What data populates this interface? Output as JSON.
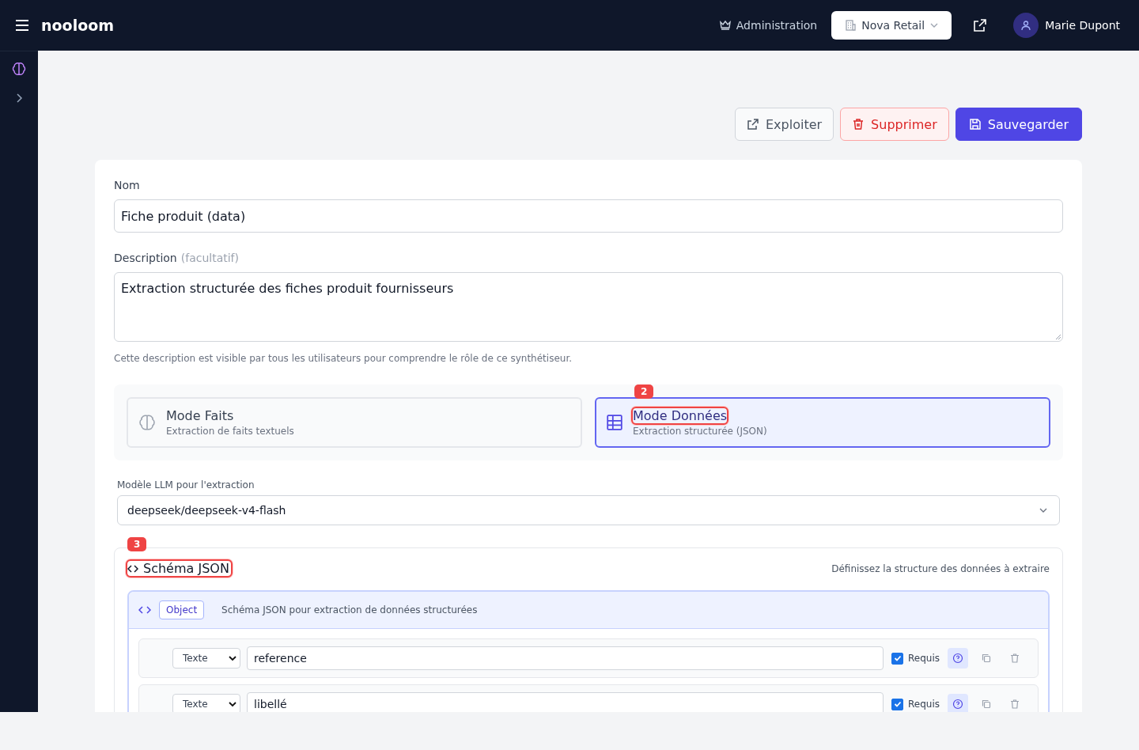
{
  "header": {
    "brand": "nooloom",
    "admin": "Administration",
    "org": "Nova Retail",
    "user": "Marie Dupont"
  },
  "actions": [
    "Exploiter",
    "Supprimer",
    "Sauvegarder"
  ],
  "form": {
    "name_label": "Nom",
    "name_value": "Fiche produit (data)",
    "desc_label": "Description",
    "desc_optional": "(facultatif)",
    "desc_value": "Extraction structurée des fiches produit fournisseurs",
    "desc_help": "Cette description est visible par tous les utilisateurs pour comprendre le rôle de ce synthétiseur."
  },
  "modes": [
    {
      "kind": "brain",
      "title": "Mode Faits",
      "subtitle": "Extraction de faits textuels",
      "selected": false
    },
    {
      "kind": "table",
      "title": "Mode Données",
      "subtitle": "Extraction structurée (JSON)",
      "selected": true,
      "marker": "2"
    }
  ],
  "model": {
    "label": "Modèle LLM pour l'extraction",
    "value": "deepseek/deepseek-v4-flash"
  },
  "schema": {
    "title": "Schéma JSON",
    "marker": "3",
    "hint": "Définissez la structure des données à extraire",
    "root_type": "Object",
    "root_desc": "Schéma JSON pour extraction de données structurées",
    "fields": [
      {
        "type": "Texte",
        "name": "reference",
        "required": true,
        "required_label": "Requis"
      },
      {
        "type": "Texte",
        "name": "libellé",
        "required": true,
        "required_label": "Requis"
      }
    ]
  }
}
